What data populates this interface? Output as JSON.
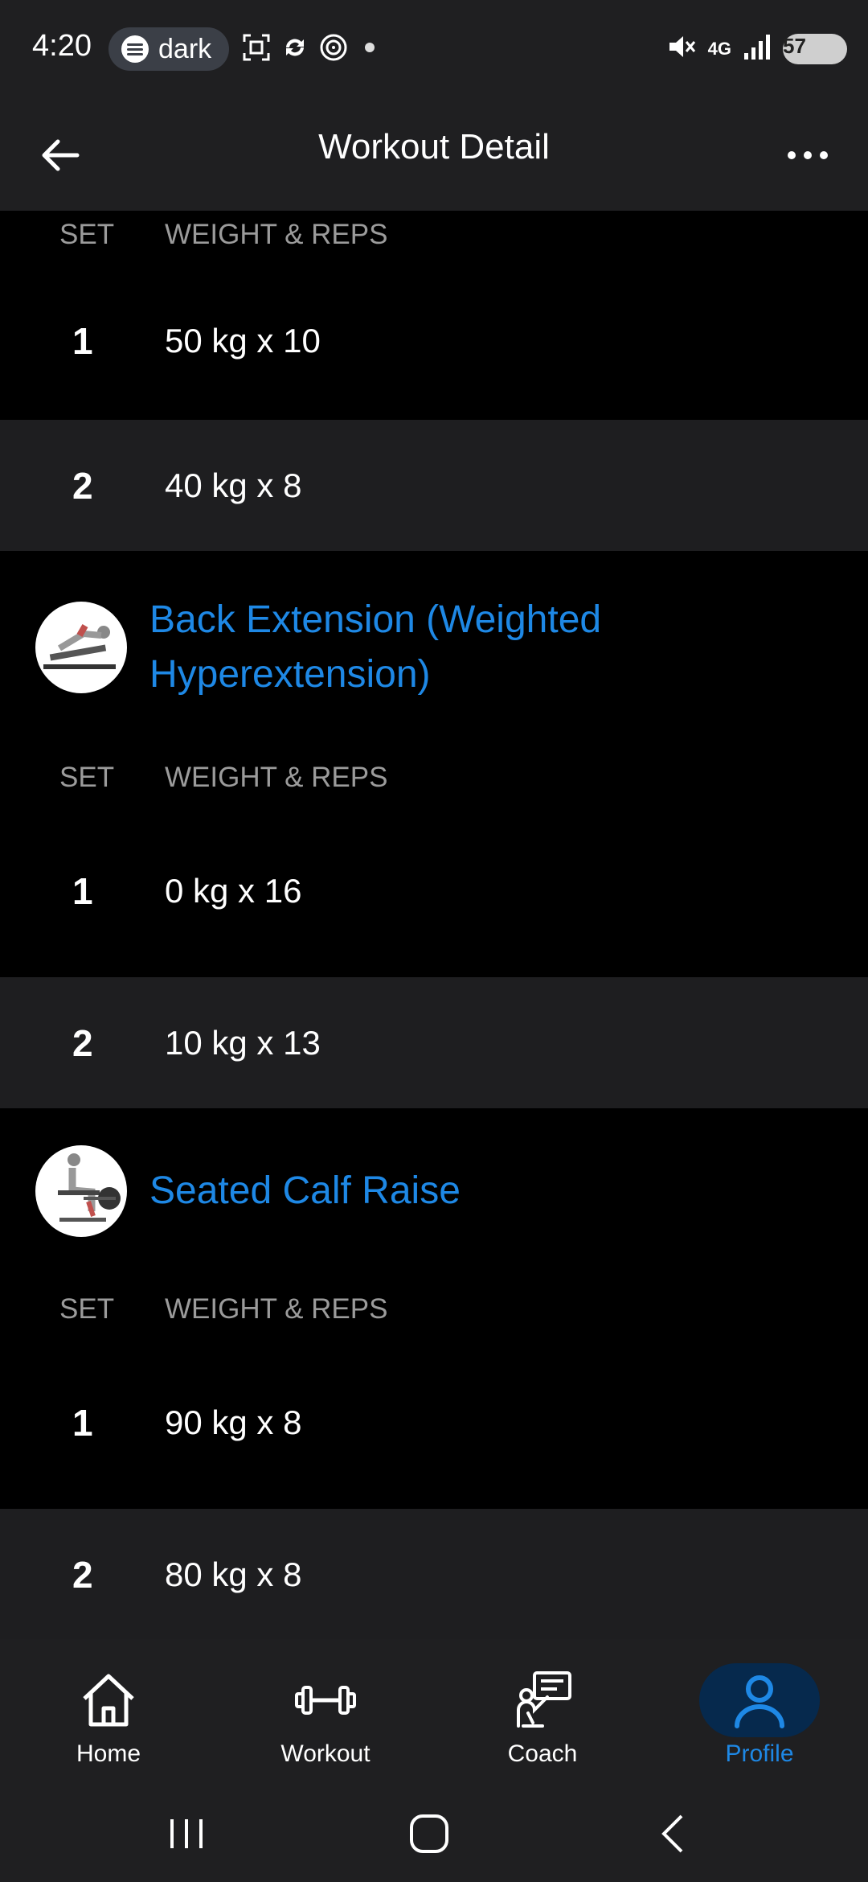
{
  "status": {
    "time": "4:20",
    "pill_label": "dark",
    "battery": "57",
    "network": "4G"
  },
  "header": {
    "title": "Workout Detail"
  },
  "columns": {
    "set": "SET",
    "weight_reps": "WEIGHT & REPS"
  },
  "first_exercise": {
    "sets": [
      {
        "num": "1",
        "value": "50 kg x 10"
      },
      {
        "num": "2",
        "value": "40 kg x 8"
      }
    ]
  },
  "exercises": [
    {
      "name": "Back Extension (Weighted Hyperextension)",
      "sets": [
        {
          "num": "1",
          "value": "0 kg x 16"
        },
        {
          "num": "2",
          "value": "10 kg x 13"
        }
      ]
    },
    {
      "name": "Seated Calf Raise",
      "sets": [
        {
          "num": "1",
          "value": "90 kg x 8"
        },
        {
          "num": "2",
          "value": "80 kg x 8"
        }
      ]
    }
  ],
  "nav": {
    "home": "Home",
    "workout": "Workout",
    "coach": "Coach",
    "profile": "Profile"
  },
  "colors": {
    "accent": "#1e88e5",
    "surface": "#1f1f21",
    "background": "#000000"
  }
}
